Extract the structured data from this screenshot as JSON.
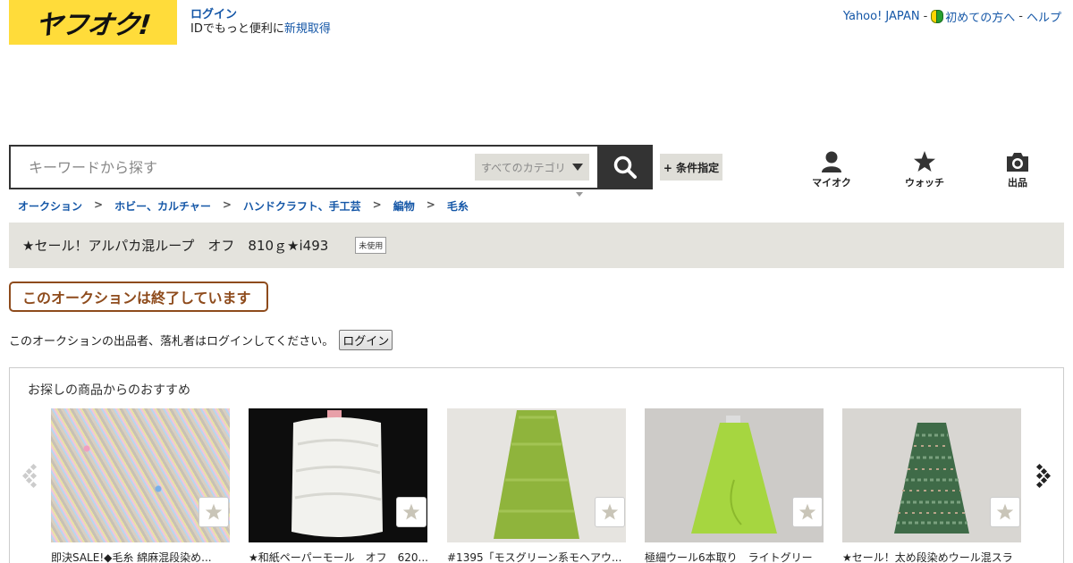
{
  "logo": "ヤフオク!",
  "login": {
    "link": "ログイン",
    "line2_prefix": "IDでもっと便利に",
    "signup": "新規取得"
  },
  "toplinks": {
    "yahoo": "Yahoo! JAPAN",
    "sep": "-",
    "beginner": "初めての方へ",
    "help": "ヘルプ"
  },
  "search": {
    "placeholder": "キーワードから探す",
    "category": "すべてのカテゴリ",
    "condition_button": "+ 条件指定"
  },
  "nav": {
    "myauction": "マイオク",
    "watch": "ウォッチ",
    "sell": "出品"
  },
  "breadcrumb": [
    "オークション",
    "ホビー、カルチャー",
    "ハンドクラフト、手工芸",
    "編物",
    "毛糸"
  ],
  "breadcrumb_sep": ">",
  "item": {
    "title": "★セール！アルパカ混ループ　オフ　810ｇ★i493",
    "condition": "未使用"
  },
  "status": {
    "ended": "このオークションは終了しています"
  },
  "notice": {
    "text": "このオークションの出品者、落札者はログインしてください。",
    "button": "ログイン"
  },
  "recommend": {
    "heading": "お探しの商品からのおすすめ",
    "items": [
      {
        "title": "即決SALE!◆毛糸 綿麻混段染め..."
      },
      {
        "title": "★和紙ペーパーモール　オフ　620..."
      },
      {
        "title": "#1395「モスグリーン系モヘアウ..."
      },
      {
        "title": "極細ウール6本取り　ライトグリー"
      },
      {
        "title": "★セール！太め段染めウール混スラ"
      }
    ]
  },
  "colors": {
    "brand_yellow": "#ffdc3a",
    "link_blue": "#1557a7",
    "ended_brown": "#8e4b1c"
  }
}
